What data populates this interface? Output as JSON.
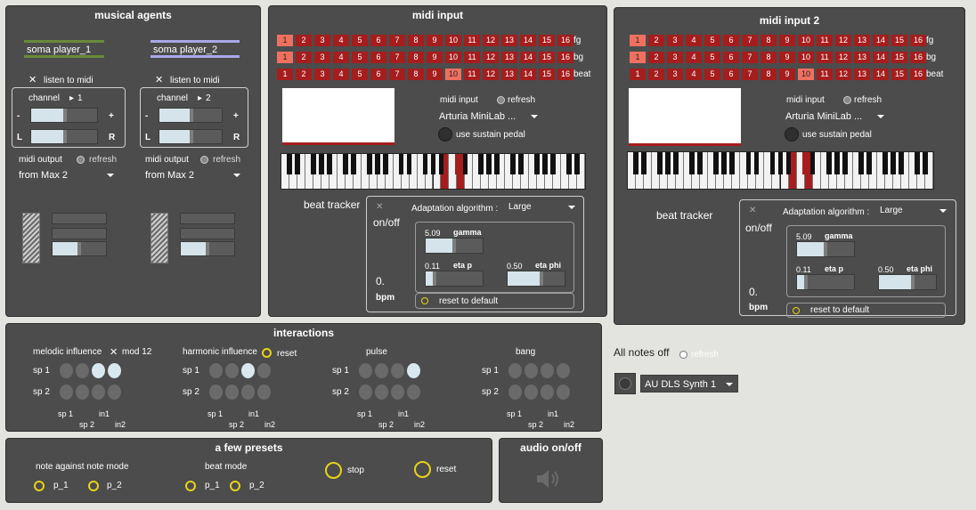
{
  "agents": {
    "title": "musical agents",
    "players": [
      {
        "name": "soma player_1",
        "listen": "listen to midi",
        "channel_label": "channel",
        "channel_value": "1",
        "midi_output": "midi output",
        "refresh": "refresh",
        "output_select": "from Max 2",
        "minus": "-",
        "plus": "+",
        "l": "L",
        "r": "R"
      },
      {
        "name": "soma player_2",
        "listen": "listen to midi",
        "channel_label": "channel",
        "channel_value": "2",
        "midi_output": "midi output",
        "refresh": "refresh",
        "output_select": "from Max 2",
        "minus": "-",
        "plus": "+",
        "l": "L",
        "r": "R"
      }
    ]
  },
  "midi_inputs": [
    {
      "title": "midi input",
      "rows": {
        "fg": "fg",
        "bg": "bg",
        "beat": "beat"
      },
      "numbers": [
        "1",
        "2",
        "3",
        "4",
        "5",
        "6",
        "7",
        "8",
        "9",
        "10",
        "11",
        "12",
        "13",
        "14",
        "15",
        "16"
      ],
      "fg_active": 1,
      "bg_active": 1,
      "beat_active": 10,
      "midi_input_label": "midi input",
      "refresh": "refresh",
      "device": "Arturia MiniLab ...",
      "sustain": "use sustain pedal",
      "beat_tracker": "beat tracker",
      "onoff": "on/off",
      "adapt_label": "Adaptation algorithm :",
      "adapt_value": "Large",
      "gamma_value": "5.09",
      "gamma_label": "gamma",
      "etap_value": "0.11",
      "etap_label": "eta p",
      "etaphi_value": "0.50",
      "etaphi_label": "eta phi",
      "bpm_value": "0.",
      "bpm_label": "bpm",
      "reset": "reset to default"
    },
    {
      "title": "midi input 2",
      "rows": {
        "fg": "fg",
        "bg": "bg",
        "beat": "beat"
      },
      "numbers": [
        "1",
        "2",
        "3",
        "4",
        "5",
        "6",
        "7",
        "8",
        "9",
        "10",
        "11",
        "12",
        "13",
        "14",
        "15",
        "16"
      ],
      "fg_active": 1,
      "bg_active": 1,
      "beat_active": 10,
      "midi_input_label": "midi input",
      "refresh": "refresh",
      "device": "Arturia MiniLab ...",
      "sustain": "use sustain pedal",
      "beat_tracker": "beat tracker",
      "onoff": "on/off",
      "adapt_label": "Adaptation algorithm :",
      "adapt_value": "Large",
      "gamma_value": "5.09",
      "gamma_label": "gamma",
      "etap_value": "0.11",
      "etap_label": "eta p",
      "etaphi_value": "0.50",
      "etaphi_label": "eta phi",
      "bpm_value": "0.",
      "bpm_label": "bpm",
      "reset": "reset to default"
    }
  ],
  "interactions": {
    "title": "interactions",
    "groups": [
      {
        "title": "melodic influence",
        "extra": "mod 12",
        "active_sp1": [
          3,
          4
        ],
        "active_sp2": []
      },
      {
        "title": "harmonic influence",
        "extra": "reset",
        "active_sp1": [
          3
        ],
        "active_sp2": []
      },
      {
        "title": "pulse",
        "extra": "",
        "active_sp1": [
          4
        ],
        "active_sp2": []
      },
      {
        "title": "bang",
        "extra": "",
        "active_sp1": [],
        "active_sp2": []
      }
    ],
    "sp1": "sp 1",
    "sp2": "sp 2",
    "in1": "in1",
    "in2": "in2"
  },
  "presets": {
    "title": "a few presets",
    "note_mode": "note against note mode",
    "beat_mode": "beat mode",
    "p1": "p_1",
    "p2": "p_2",
    "stop": "stop",
    "reset": "reset"
  },
  "audio": {
    "title": "audio on/off",
    "icon": "speaker-icon"
  },
  "extras": {
    "all_notes_off": "All notes off",
    "refresh": "refresh",
    "synth": "AU DLS Synth 1"
  },
  "colors": {
    "panel": "#4b4c4b",
    "accent_red": "#a61d1d",
    "active_cell": "#f07060",
    "yellow": "#e8d21a",
    "player1": "#6a8a3a",
    "player2": "#a9a8e8"
  }
}
